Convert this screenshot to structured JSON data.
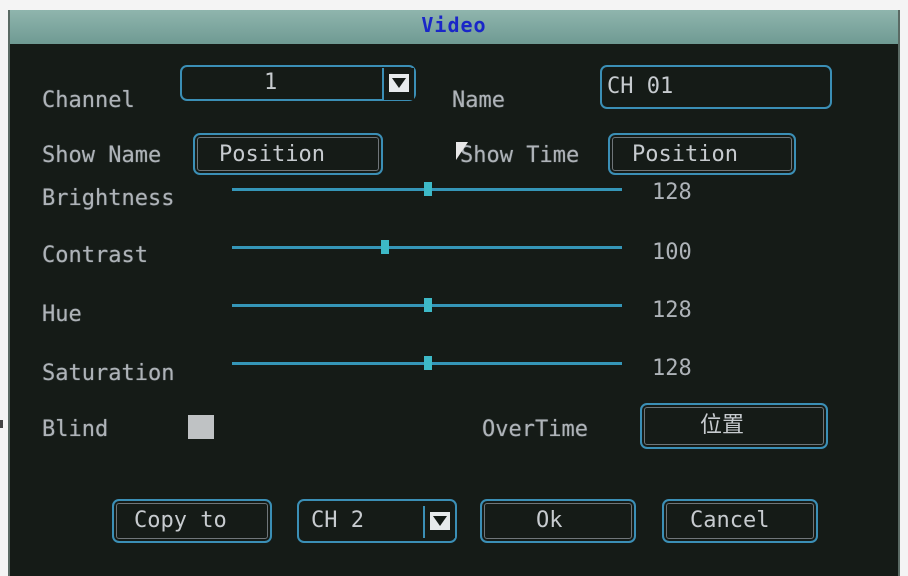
{
  "dialog": {
    "title": "Video"
  },
  "channel": {
    "label": "Channel",
    "value": "1"
  },
  "name": {
    "label": "Name",
    "value": "CH 01"
  },
  "show_name": {
    "label": "Show Name",
    "button": "Position"
  },
  "show_time": {
    "label": "Show Time",
    "button": "Position"
  },
  "sliders": [
    {
      "label": "Brightness",
      "value": 128,
      "max": 255
    },
    {
      "label": "Contrast",
      "value": 100,
      "max": 255
    },
    {
      "label": "Hue",
      "value": 128,
      "max": 255
    },
    {
      "label": "Saturation",
      "value": 128,
      "max": 255
    }
  ],
  "blind": {
    "label": "Blind",
    "checked": false
  },
  "overtime": {
    "label": "OverTime",
    "button": "位置"
  },
  "footer": {
    "copy_to": "Copy to",
    "target_channel": "CH  2",
    "ok": "Ok",
    "cancel": "Cancel"
  },
  "icons": {
    "dropdown": "chevron-down-icon",
    "cursor": "mouse-pointer-icon"
  },
  "colors": {
    "title_bg": "#7aa59d",
    "title_text": "#1a26c8",
    "accent": "#3b8fb6",
    "panel_bg": "#151b17"
  }
}
